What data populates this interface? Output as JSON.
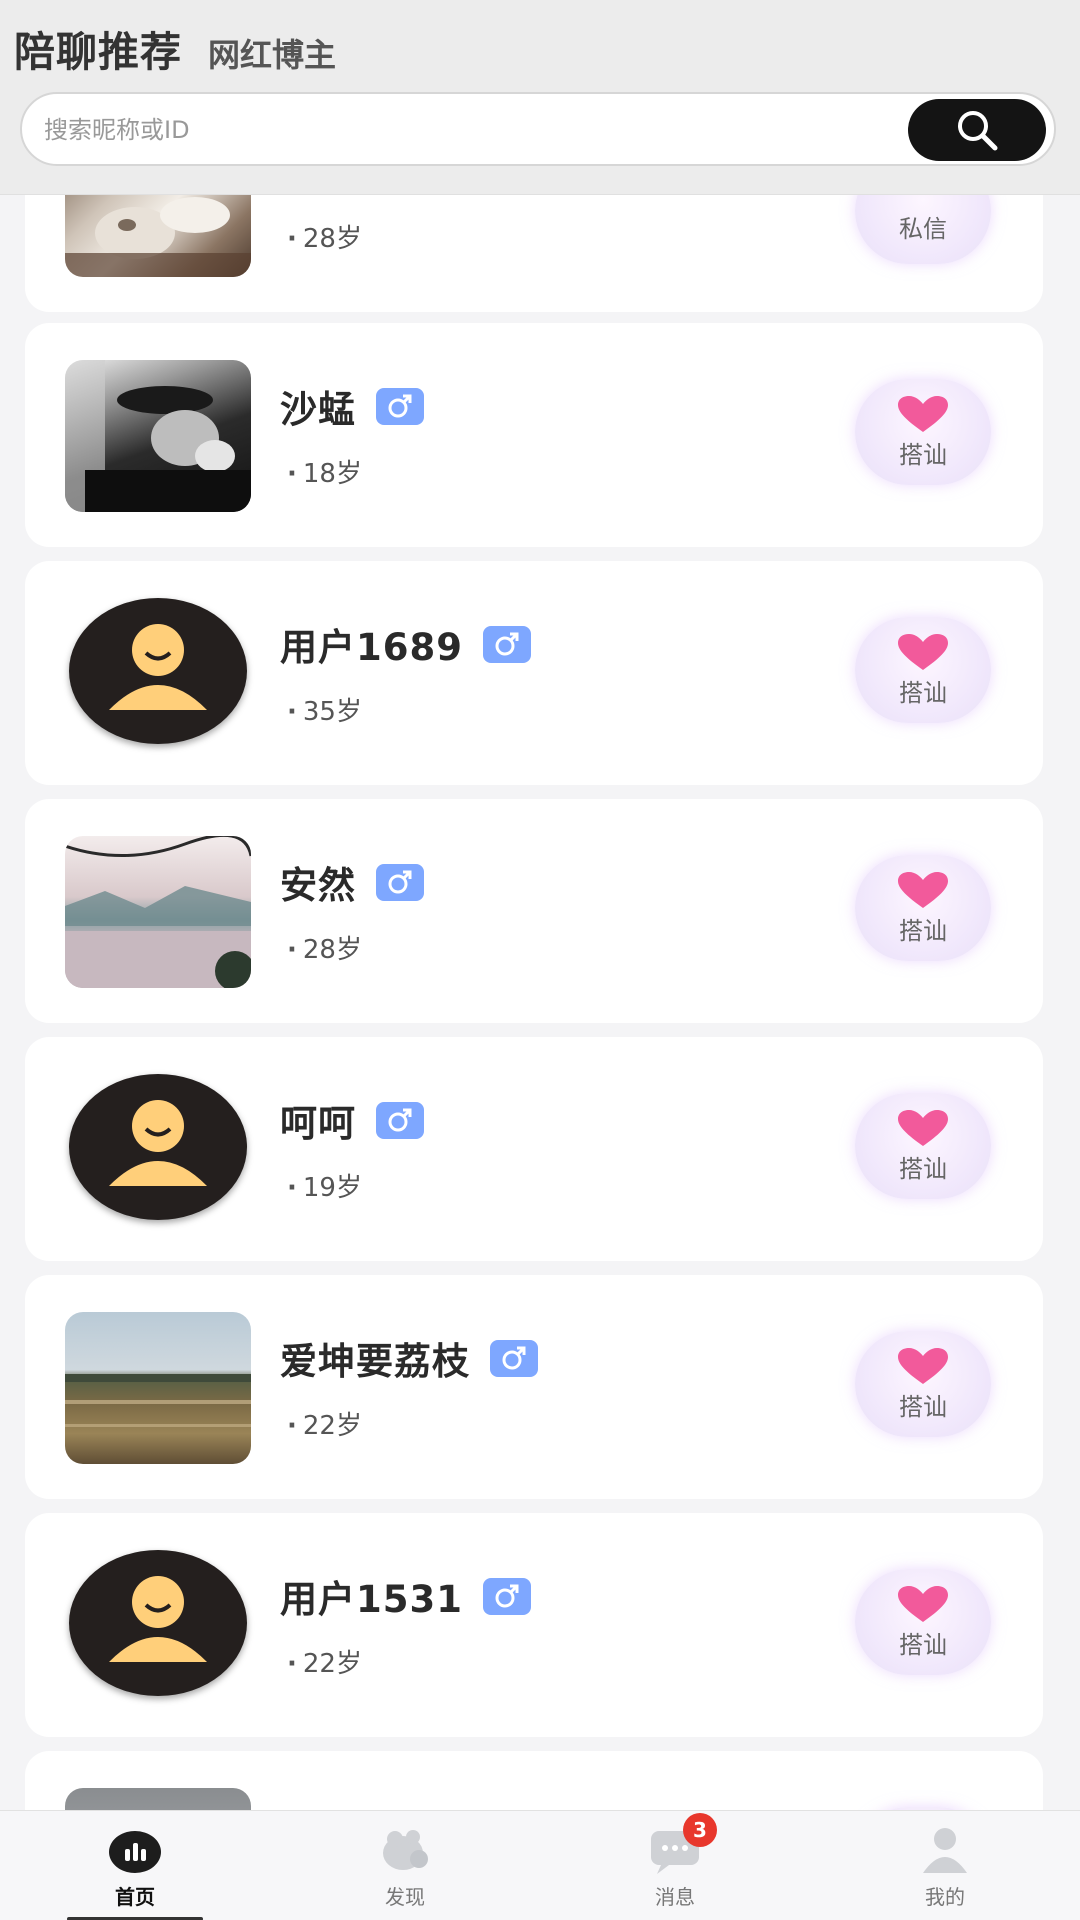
{
  "header": {
    "tab_active": "陪聊推荐",
    "tab_other": "网红博主"
  },
  "search": {
    "placeholder": "搜索昵称或ID",
    "button_icon": "search-icon"
  },
  "cards": [
    {
      "name": "",
      "age": "28岁",
      "action": "私信",
      "avatar": "cat-photo",
      "gender": "male"
    },
    {
      "name": "沙蜢",
      "age": "18岁",
      "action": "搭讪",
      "avatar": "bw-portrait-photo",
      "gender": "male"
    },
    {
      "name": "用户1689",
      "age": "35岁",
      "action": "搭讪",
      "avatar": "default-avatar",
      "gender": "male"
    },
    {
      "name": "安然",
      "age": "28岁",
      "action": "搭讪",
      "avatar": "lake-landscape-photo",
      "gender": "male"
    },
    {
      "name": "呵呵",
      "age": "19岁",
      "action": "搭讪",
      "avatar": "default-avatar",
      "gender": "male"
    },
    {
      "name": "爱坤要荔枝",
      "age": "22岁",
      "action": "搭讪",
      "avatar": "field-landscape-photo",
      "gender": "male"
    },
    {
      "name": "用户1531",
      "age": "22岁",
      "action": "搭讪",
      "avatar": "default-avatar",
      "gender": "male"
    }
  ],
  "nav": {
    "home": "首页",
    "discover": "发现",
    "messages": "消息",
    "messages_badge": "3",
    "me": "我的"
  },
  "colors": {
    "gender_badge": "#7ea7ff",
    "heart": "#f25a9b",
    "badge": "#e8372c",
    "default_avatar_bg": "#241f1e",
    "default_avatar_figure": "#ffcf7a"
  }
}
